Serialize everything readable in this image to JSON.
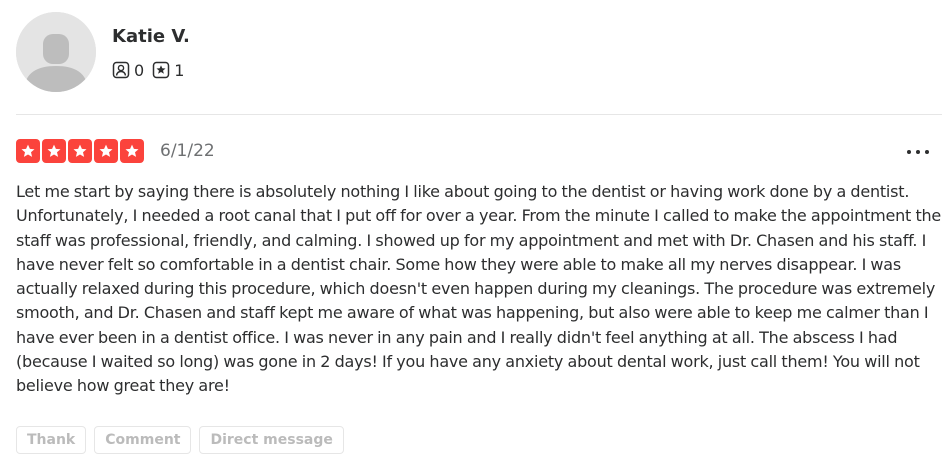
{
  "user": {
    "name": "Katie V.",
    "stats": {
      "friends_count": "0",
      "reviews_count": "1"
    }
  },
  "review": {
    "rating": 5,
    "max_rating": 5,
    "date": "6/1/22",
    "star_color": "#fb433c",
    "text": "Let me start by saying there is absolutely nothing I like about going to the dentist or having work done by a dentist. Unfortunately, I needed a root canal that I put off for over a year. From the minute I called to make the appointment the staff was professional, friendly, and calming. I showed up for my appointment and met with Dr. Chasen and his staff. I have never felt so comfortable in a dentist chair. Some how they were able to make all my nerves disappear. I was actually relaxed during this procedure, which doesn't even happen during my cleanings. The procedure was extremely smooth, and Dr. Chasen and staff kept me aware of what was happening, but also were able to keep me calmer than I have ever been in a dentist office. I was never in any pain and I really didn't feel anything at all. The abscess I had (because I waited so long) was gone in 2 days! If you have any anxiety about dental work, just call them! You will not believe how great they are!"
  },
  "actions": {
    "thank_label": "Thank",
    "comment_label": "Comment",
    "message_label": "Direct message"
  },
  "icons": {
    "avatar": "default-user-avatar",
    "friends": "friends-icon",
    "reviews": "review-star-icon",
    "more": "more-options-icon"
  }
}
